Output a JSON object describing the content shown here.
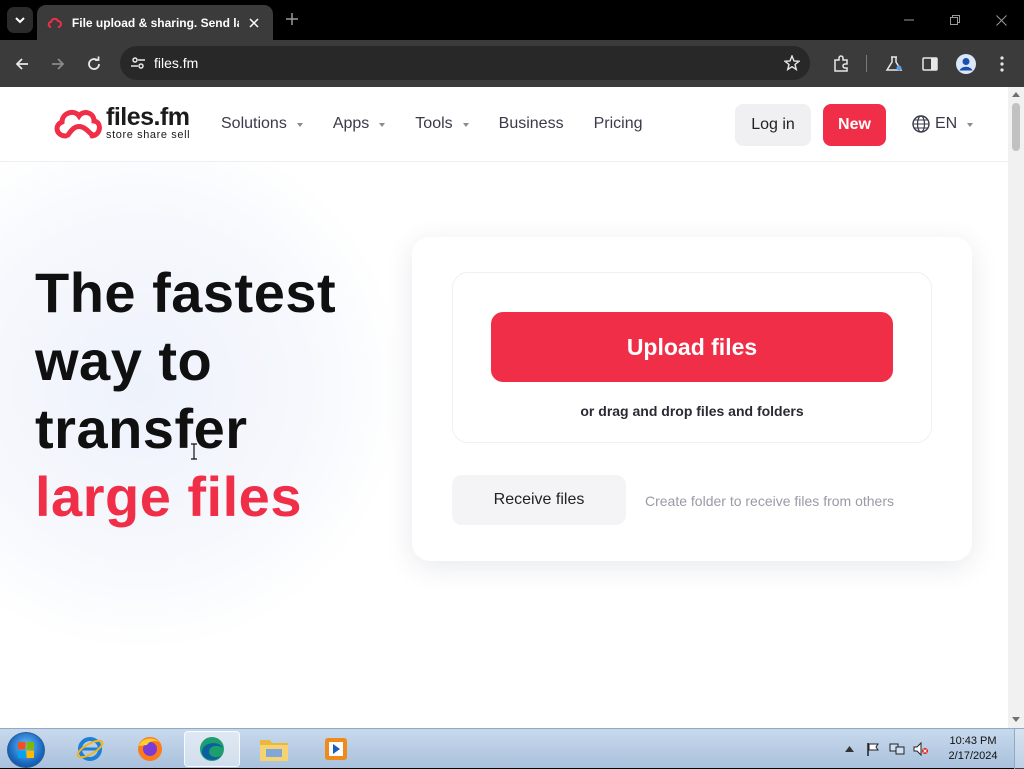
{
  "browser": {
    "tab_title": "File upload & sharing. Send large files",
    "url": "files.fm",
    "icons": [
      "tab-search-icon",
      "files-fm-favicon-icon",
      "close-icon",
      "plus-icon",
      "minimize-icon",
      "restore-icon",
      "close-window-icon",
      "back-icon",
      "forward-icon",
      "reload-icon",
      "site-info-icon",
      "star-icon",
      "extensions-icon",
      "labs-icon",
      "side-panel-icon",
      "profile-icon",
      "menu-icon"
    ]
  },
  "site": {
    "logo": {
      "name": "files.fm",
      "tagline": "store share sell"
    },
    "nav": [
      {
        "label": "Solutions",
        "has_caret": true
      },
      {
        "label": "Apps",
        "has_caret": true
      },
      {
        "label": "Tools",
        "has_caret": true
      },
      {
        "label": "Business",
        "has_caret": false
      },
      {
        "label": "Pricing",
        "has_caret": false
      }
    ],
    "login_label": "Log in",
    "new_label": "New",
    "language": "EN"
  },
  "hero": {
    "line1": "The fastest",
    "line2": "way to",
    "line3": "transfer",
    "line4": "large files"
  },
  "upload_card": {
    "upload_label": "Upload files",
    "drop_hint": "or drag and drop files and folders",
    "receive_label": "Receive files",
    "receive_hint": "Create folder to receive files from others"
  },
  "taskbar": {
    "apps": [
      "internet-explorer-icon",
      "firefox-icon",
      "chrome-edge-icon",
      "file-explorer-icon",
      "media-player-icon"
    ],
    "time": "10:43 PM",
    "date": "2/17/2024"
  },
  "colors": {
    "accent": "#f02e47",
    "chrome_dark": "#3b3b3b",
    "text_dark": "#101010"
  }
}
